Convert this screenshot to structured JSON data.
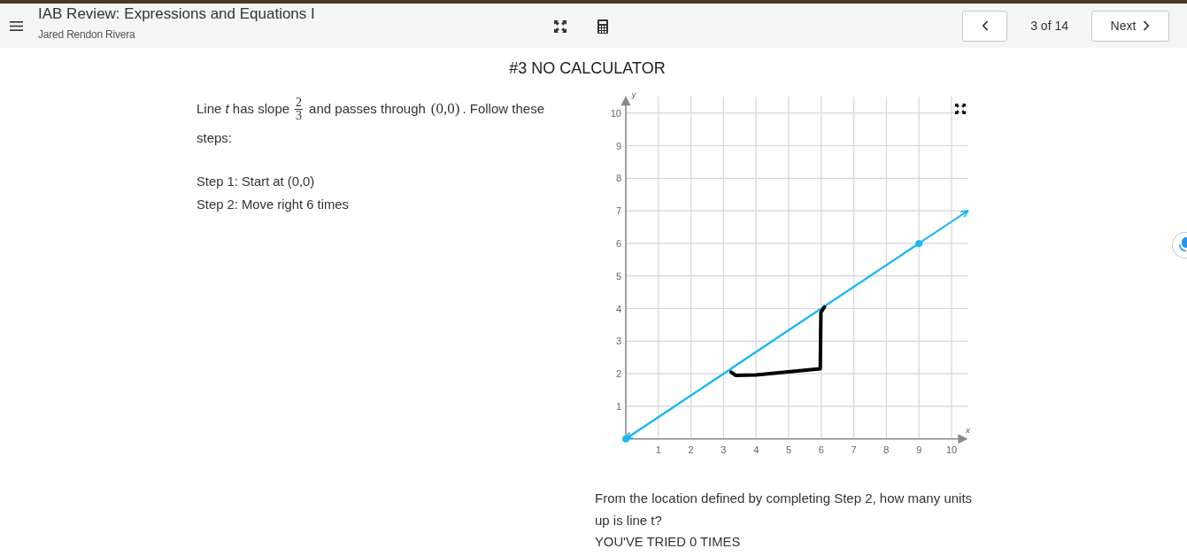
{
  "header": {
    "title": "IAB Review: Expressions and Equations I",
    "student": "Jared Rendon Rivera",
    "position": "3 of 14",
    "next_label": "Next"
  },
  "question": {
    "heading": "#3 NO CALCULATOR",
    "prompt": {
      "before": "Line *t* has slope",
      "fraction": {
        "numerator": "2",
        "denominator": "3"
      },
      "middle": "and passes through",
      "point": "(0,0)",
      "after": ". Follow these steps:"
    },
    "steps": [
      "Step 1: Start at (0,0)",
      "Step 2: Move right 6 times"
    ],
    "graph": {
      "chart_data": {
        "type": "line",
        "xlabel": "x",
        "ylabel": "y",
        "x": [
          0,
          3.23,
          3.37,
          4,
          5.97,
          5.99,
          6.1,
          9,
          10.5
        ],
        "series": [
          {
            "color": "#1ab8f0",
            "values": [
              0,
              null,
              null,
              null,
              null,
              null,
              null,
              6,
              null
            ],
            "marker": "circle"
          },
          {
            "color": "#1ab8f0",
            "values": [
              0,
              2.15,
              2.25,
              2.67,
              3.98,
              3.99,
              4.07,
              6,
              7
            ]
          },
          {
            "color": "#000000",
            "values": [
              null,
              2.05,
              1.95,
              1.96,
              2.15,
              3.88,
              4.05,
              null,
              null
            ]
          }
        ],
        "xlim": [
          0,
          10.5
        ],
        "ylim": [
          0,
          10.5
        ],
        "xticks": [
          1,
          2,
          3,
          4,
          5,
          6,
          7,
          8,
          9,
          10
        ],
        "yticks": [
          1,
          2,
          3,
          4,
          5,
          6,
          7,
          8,
          9,
          10
        ],
        "grid": true
      }
    },
    "ask": "From the location defined by completing Step 2, how many units up is line t?",
    "attempts": "YOU'VE TRIED 0 TIMES"
  }
}
